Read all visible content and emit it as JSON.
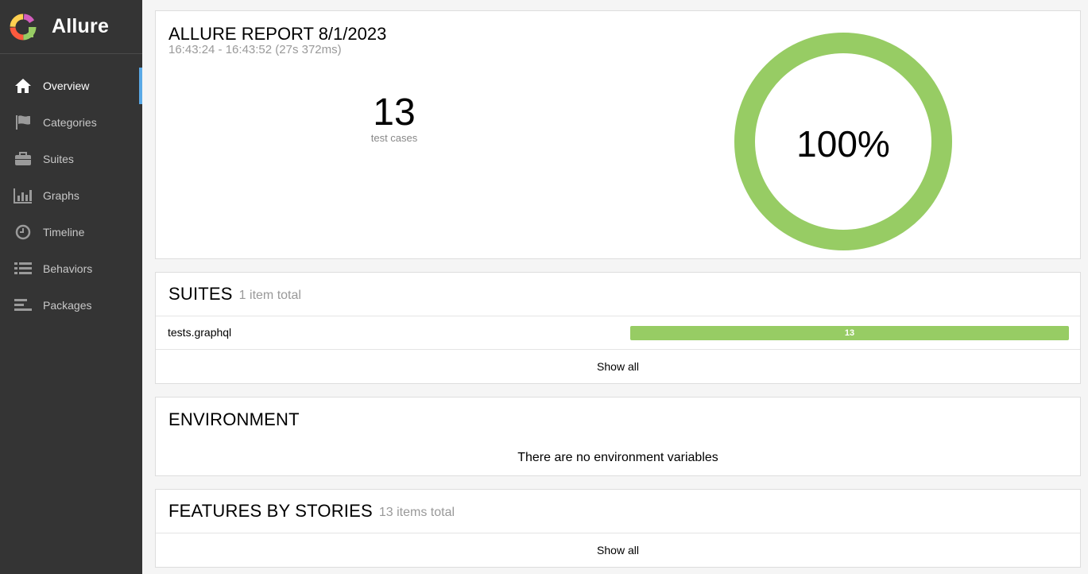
{
  "app": {
    "name": "Allure"
  },
  "colors": {
    "sidebar": "#343434",
    "accent": "#5aa9e6",
    "passed": "#97cc64"
  },
  "sidebar": {
    "items": [
      {
        "label": "Overview",
        "icon": "home-icon",
        "active": true
      },
      {
        "label": "Categories",
        "icon": "flag-icon"
      },
      {
        "label": "Suites",
        "icon": "briefcase-icon"
      },
      {
        "label": "Graphs",
        "icon": "bar-chart-icon"
      },
      {
        "label": "Timeline",
        "icon": "clock-icon"
      },
      {
        "label": "Behaviors",
        "icon": "list-icon"
      },
      {
        "label": "Packages",
        "icon": "align-left-icon"
      }
    ]
  },
  "summary": {
    "title": "ALLURE REPORT 8/1/2023",
    "time": "16:43:24 - 16:43:52 (27s 372ms)",
    "count": "13",
    "count_label": "test cases",
    "pass_rate": "100%",
    "pass_fraction": 1.0
  },
  "suites": {
    "title": "SUITES",
    "subtitle": "1 item total",
    "rows": [
      {
        "name": "tests.graphql",
        "count": "13"
      }
    ],
    "show_all": "Show all"
  },
  "environment": {
    "title": "ENVIRONMENT",
    "empty": "There are no environment variables"
  },
  "features": {
    "title": "FEATURES BY STORIES",
    "subtitle": "13 items total",
    "show_all": "Show all"
  }
}
